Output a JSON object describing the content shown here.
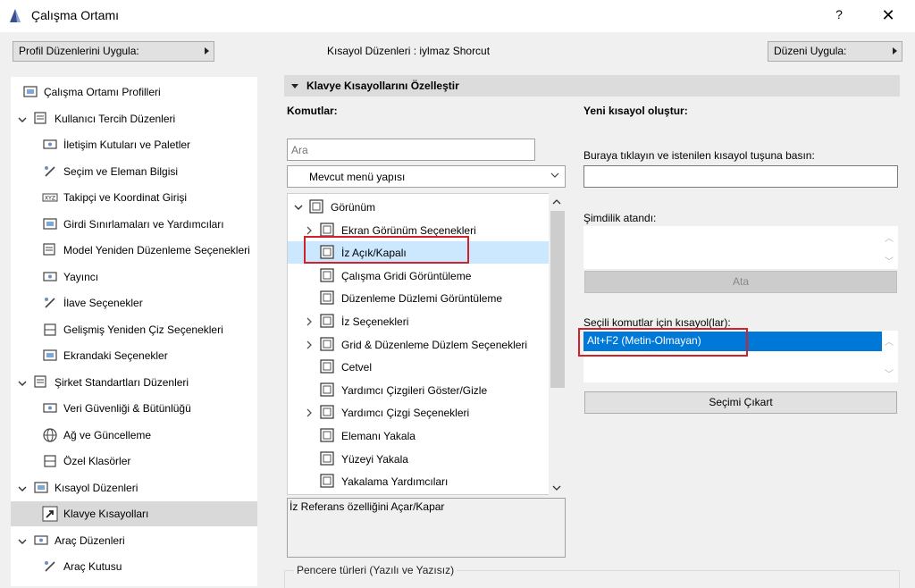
{
  "window": {
    "title": "Çalışma Ortamı",
    "help": "?",
    "close": "✕"
  },
  "toolbar": {
    "profile_button": "Profil Düzenlerini Uygula:",
    "shortcut_scheme_label": "Kısayol Düzenleri :  iylmaz Shorcut",
    "apply_button": "Düzeni Uygula:"
  },
  "sidebar": {
    "items": [
      {
        "label": "Çalışma Ortamı Profilleri",
        "icon": "workspace-profiles-icon"
      },
      {
        "label": "Kullanıcı Tercih Düzenleri",
        "icon": "user-preferences-icon",
        "expanded": true
      },
      {
        "label": "İletişim Kutuları ve Paletler",
        "icon": "dialogs-palettes-icon"
      },
      {
        "label": "Seçim ve Eleman Bilgisi",
        "icon": "selection-info-icon"
      },
      {
        "label": "Takipçi ve Koordinat Girişi",
        "icon": "tracker-xyz-icon"
      },
      {
        "label": "Girdi Sınırlamaları ve Yardımcıları",
        "icon": "input-constraints-icon"
      },
      {
        "label": "Model Yeniden Düzenleme Seçenekleri",
        "icon": "model-rebuild-icon"
      },
      {
        "label": "Yayıncı",
        "icon": "publisher-icon"
      },
      {
        "label": "İlave Seçenekler",
        "icon": "more-options-icon"
      },
      {
        "label": "Gelişmiş Yeniden Çiz Seçenekleri",
        "icon": "redraw-options-icon"
      },
      {
        "label": "Ekrandaki Seçenekler",
        "icon": "onscreen-options-icon"
      },
      {
        "label": "Şirket Standartları Düzenleri",
        "icon": "company-standards-icon",
        "expanded": true
      },
      {
        "label": "Veri Güvenliği & Bütünlüğü",
        "icon": "data-safety-icon"
      },
      {
        "label": "Ağ ve Güncelleme",
        "icon": "network-globe-icon"
      },
      {
        "label": "Özel Klasörler",
        "icon": "special-folders-icon"
      },
      {
        "label": "Kısayol Düzenleri",
        "icon": "shortcut-schemes-icon",
        "expanded": true
      },
      {
        "label": "Klavye Kısayolları",
        "icon": "keyboard-shortcuts-icon",
        "selected": true
      },
      {
        "label": "Araç Düzenleri",
        "icon": "tool-schemes-icon",
        "expanded": true
      },
      {
        "label": "Araç Kutusu",
        "icon": "toolbox-icon"
      }
    ]
  },
  "section": {
    "title": "Klavye Kısayollarını Özelleştir"
  },
  "commands": {
    "label": "Komutlar:",
    "search_placeholder": "Ara",
    "menu_select": "Mevcut menü yapısı",
    "tree": [
      {
        "label": "Görünüm",
        "caret": "down",
        "level": 0
      },
      {
        "label": "Ekran Görünüm Seçenekleri",
        "caret": "right",
        "level": 1
      },
      {
        "label": "İz Açık/Kapalı",
        "caret": "none",
        "level": 1,
        "selected": true
      },
      {
        "label": "Çalışma Gridi Görüntüleme",
        "caret": "none",
        "level": 1
      },
      {
        "label": "Düzenleme Düzlemi Görüntüleme",
        "caret": "none",
        "level": 1
      },
      {
        "label": "İz Seçenekleri",
        "caret": "right",
        "level": 1
      },
      {
        "label": "Grid & Düzenleme Düzlem Seçenekleri",
        "caret": "right",
        "level": 1
      },
      {
        "label": "Cetvel",
        "caret": "none",
        "level": 1
      },
      {
        "label": "Yardımcı Çizgileri Göster/Gizle",
        "caret": "none",
        "level": 1
      },
      {
        "label": "Yardımcı Çizgi Seçenekleri",
        "caret": "right",
        "level": 1
      },
      {
        "label": "Elemanı Yakala",
        "caret": "none",
        "level": 1
      },
      {
        "label": "Yüzeyi Yakala",
        "caret": "none",
        "level": 1
      },
      {
        "label": "Yakalama Yardımcıları",
        "caret": "none",
        "level": 1
      }
    ],
    "description": "İz Referans özelliğini Açar/Kapar"
  },
  "new_shortcut": {
    "label": "Yeni kısayol oluştur:",
    "press_label": "Buraya tıklayın ve istenilen kısayol tuşuna basın:",
    "current_label": "Şimdilik atandı:",
    "assign_button": "Ata",
    "selected_label": "Seçili komutlar için kısayol(lar):",
    "selected_shortcut": "Alt+F2 (Metin-Olmayan)",
    "remove_button": "Seçimi Çıkart"
  },
  "frame": {
    "label": "Pencere türleri (Yazılı ve Yazısız)"
  },
  "colors": {
    "accent": "#0078d7",
    "highlight": "#d1212b",
    "selection": "#cce8ff"
  }
}
